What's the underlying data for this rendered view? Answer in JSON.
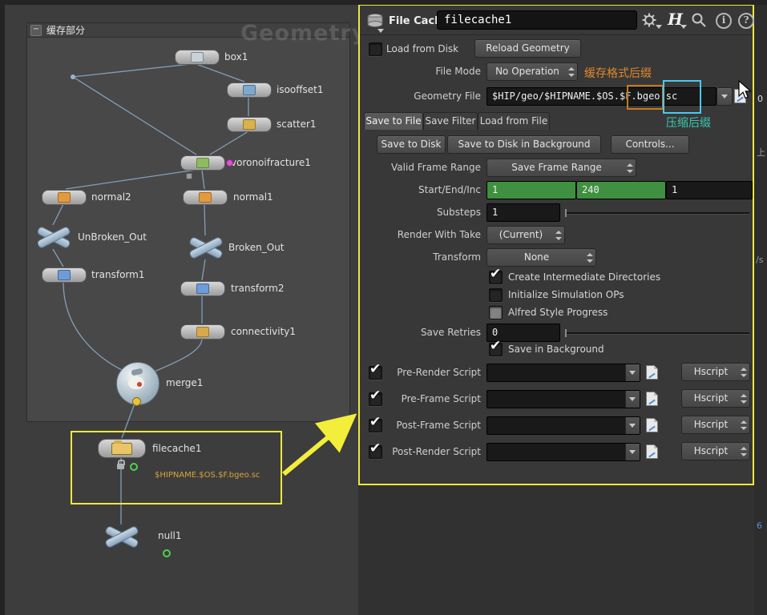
{
  "window": {
    "watermark": "Geometry"
  },
  "icons": {
    "houdini_logo": "H",
    "info_glyph": "i",
    "help_glyph": "?",
    "collapse_glyph": "−"
  },
  "network": {
    "box_title": "缓存部分",
    "nodes": {
      "box1": "box1",
      "isooffset1": "isooffset1",
      "scatter1": "scatter1",
      "voronoifracture1": "voronoifracture1",
      "normal2": "normal2",
      "normal1": "normal1",
      "unbroken_out": "UnBroken_Out",
      "broken_out": "Broken_Out",
      "transform1": "transform1",
      "transform2": "transform2",
      "connectivity1": "connectivity1",
      "merge1": "merge1",
      "filecache1": "filecache1",
      "null1": "null1"
    },
    "filecache_caption": "$HIPNAME.$OS.$F.bgeo.sc"
  },
  "panel": {
    "header": {
      "type_label": "File Cache",
      "name_value": "filecache1"
    },
    "load_from_disk_label": "Load from Disk",
    "reload_geometry_label": "Reload Geometry",
    "file_mode": {
      "label": "File Mode",
      "value": "No Operation"
    },
    "geometry_file": {
      "label": "Geometry File",
      "value_prefix": "$HIP/geo/$HIPNAME.$OS.$F",
      "value_bgeo": ".bgeo",
      "value_sc": ".sc"
    },
    "tabs": {
      "tab1": "Save to File",
      "tab2": "Save Filter",
      "tab3": "Load from File"
    },
    "actions": {
      "save_to_disk": "Save to Disk",
      "save_bg": "Save to Disk in Background",
      "controls": "Controls..."
    },
    "valid_frame_range": {
      "label": "Valid Frame Range",
      "value": "Save Frame Range"
    },
    "start_end_inc": {
      "label": "Start/End/Inc",
      "start": "1",
      "end": "240",
      "inc": "1"
    },
    "substeps": {
      "label": "Substeps",
      "value": "1"
    },
    "render_with_take": {
      "label": "Render With Take",
      "value": "(Current)"
    },
    "transform": {
      "label": "Transform",
      "value": "None"
    },
    "toggles": {
      "create_dirs": "Create Intermediate Directories",
      "init_sim": "Initialize Simulation OPs",
      "alfred": "Alfred Style Progress",
      "save_in_bg": "Save in Background"
    },
    "save_retries": {
      "label": "Save Retries",
      "value": "0"
    },
    "scripts": {
      "pre_render": "Pre-Render Script",
      "pre_frame": "Pre-Frame Script",
      "post_frame": "Post-Frame Script",
      "post_render": "Post-Render Script",
      "lang": "Hscript"
    }
  },
  "annotations": {
    "format_suffix": "缓存格式后缀",
    "compress_suffix": "压缩后缀"
  },
  "edge_fragments": {
    "f0": "0",
    "f1": "上",
    "f2": "/s",
    "f3": "6"
  },
  "colors": {
    "highlight": "#ebe73b",
    "annotation_orange": "#e0882a",
    "annotation_teal": "#38c9b0",
    "suffix_box_orange": "#c87a20",
    "suffix_box_cyan": "#4cc8ee",
    "range_field_green": "#3f9040",
    "caption_orange": "#d8a43c"
  }
}
